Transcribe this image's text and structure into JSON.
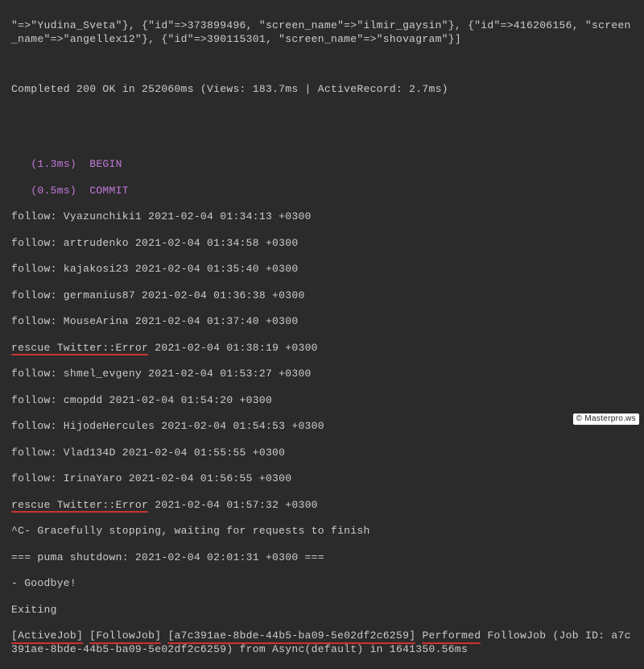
{
  "header_block": "\"=>\"Yudina_Sveta\"}, {\"id\"=>373899496, \"screen_name\"=>\"ilmir_gaysin\"}, {\"id\"=>416206156, \"screen_name\"=>\"angellex12\"}, {\"id\"=>390115301, \"screen_name\"=>\"shovagram\"}]",
  "completed_line": "Completed 200 OK in 252060ms (Views: 183.7ms | ActiveRecord: 2.7ms)",
  "tx": {
    "begin_time": "(1.3ms)",
    "begin_label": "BEGIN",
    "commit_time": "(0.5ms)",
    "commit_label": "COMMIT"
  },
  "lines": {
    "f1": "follow: Vyazunchiki1 2021-02-04 01:34:13 +0300",
    "f2": "follow: artrudenko 2021-02-04 01:34:58 +0300",
    "f3": "follow: kajakosi23 2021-02-04 01:35:40 +0300",
    "f4": "follow: germanius87 2021-02-04 01:36:38 +0300",
    "f5": "follow: MouseArina 2021-02-04 01:37:40 +0300",
    "r1_u": "rescue Twitter::Error",
    "r1_rest": " 2021-02-04 01:38:19 +0300",
    "f6": "follow: shmel_evgeny 2021-02-04 01:53:27 +0300",
    "f7": "follow: cmopdd 2021-02-04 01:54:20 +0300",
    "f8": "follow: HijodeHercules 2021-02-04 01:54:53 +0300",
    "f9": "follow: Vlad134D 2021-02-04 01:55:55 +0300",
    "f10": "follow: IrinaYaro 2021-02-04 01:56:55 +0300",
    "r2_u": "rescue Twitter::Error",
    "r2_rest": " 2021-02-04 01:57:32 +0300",
    "stop": "^C- Gracefully stopping, waiting for requests to finish",
    "puma": "=== puma shutdown: 2021-02-04 02:01:31 +0300 ===",
    "goodbye": "- Goodbye!",
    "exiting": "Exiting",
    "aj1": "[ActiveJob]",
    "aj2": "[FollowJob]",
    "aj3": "[a7c391ae-8bde-44b5-ba09-5e02df2c6259]",
    "aj4": "Performed",
    "aj_rest1": " FollowJob (Job ID: a7c391ae-8bde-44b5-ba09-5e02df2c6259) from Async(default) in 1641350.56ms"
  },
  "watermark": "© Masterpro.ws"
}
